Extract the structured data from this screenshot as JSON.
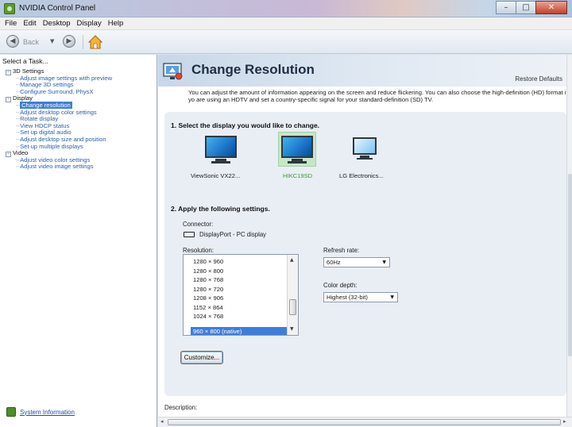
{
  "window": {
    "title": "NVIDIA Control Panel"
  },
  "menu": [
    "File",
    "Edit",
    "Desktop",
    "Display",
    "Help"
  ],
  "toolbar": {
    "back_label": "Back"
  },
  "task_panel": {
    "title": "Select a Task...",
    "categories": [
      {
        "label": "3D Settings",
        "items": [
          "Adjust image settings with preview",
          "Manage 3D settings",
          "Configure Surround, PhysX"
        ]
      },
      {
        "label": "Display",
        "items": [
          "Change resolution",
          "Adjust desktop color settings",
          "Rotate display",
          "View HDCP status",
          "Set up digital audio",
          "Adjust desktop size and position",
          "Set up multiple displays"
        ]
      },
      {
        "label": "Video",
        "items": [
          "Adjust video color settings",
          "Adjust video image settings"
        ]
      }
    ],
    "selected_item": "Change resolution",
    "system_info_link": "System Information"
  },
  "page": {
    "title": "Change Resolution",
    "restore_defaults": "Restore Defaults",
    "description": "You can adjust the amount of information appearing on the screen and reduce flickering. You can also choose the high-definition (HD) format if yo are using an HDTV and set a country-specific signal for your standard-definition (SD) TV.",
    "step1": "1. Select the display you would like to change.",
    "displays": [
      "ViewSonic VX22...",
      "HIKC19SD",
      "LG Electronics..."
    ],
    "selected_display_index": 1,
    "step2": "2. Apply the following settings.",
    "connector_label": "Connector:",
    "connector_value": "DisplayPort - PC display",
    "resolution_label": "Resolution:",
    "resolutions": [
      "1280 × 960",
      "1280 × 800",
      "1280 × 768",
      "1280 × 720",
      "1208 × 906",
      "1152 × 864",
      "1024 × 768",
      "960 × 800 (native)"
    ],
    "selected_resolution": "960 × 800 (native)",
    "refresh_label": "Refresh rate:",
    "refresh_value": "60Hz",
    "color_depth_label": "Color depth:",
    "color_depth_value": "Highest (32-bit)",
    "customize_button": "Customize...",
    "description_label": "Description:"
  },
  "colors": {
    "selection": "#3d7edb",
    "header": "#c7d7e9",
    "content_box": "#e9eef5",
    "selected_display": "#3b9b2e"
  }
}
